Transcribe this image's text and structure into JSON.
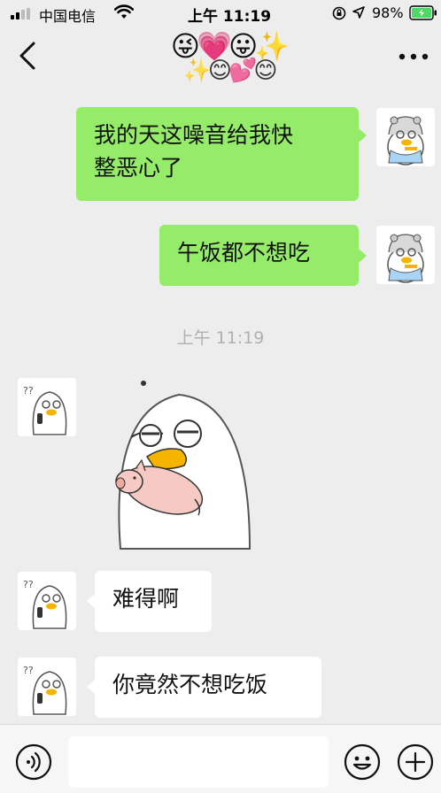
{
  "status_bar": {
    "carrier": "中国电信",
    "time": "上午 11:19",
    "battery": "98%"
  },
  "nav": {
    "title_emoji_row1": "😜💗😛✨",
    "title_emoji_row2": "✨😊💕😊"
  },
  "messages": [
    {
      "side": "right",
      "text_line1": "我的天这噪音给我快",
      "text_line2": "整恶心了"
    },
    {
      "side": "right",
      "text": "午饭都不想吃"
    },
    {
      "side": "left",
      "type": "sticker",
      "sticker": "duck-holding-pig"
    },
    {
      "side": "left",
      "text": "难得啊"
    },
    {
      "side": "left",
      "text": "你竟然不想吃饭"
    }
  ],
  "timestamp": "上午 11:19",
  "input": {
    "value": "",
    "placeholder": ""
  },
  "icons": {
    "back": "chevron-left-icon",
    "more": "more-dots-icon",
    "voice": "voice-icon",
    "emoji": "emoji-icon",
    "plus": "plus-icon"
  },
  "colors": {
    "bubble_green": "#95ec69",
    "background": "#ededed"
  }
}
